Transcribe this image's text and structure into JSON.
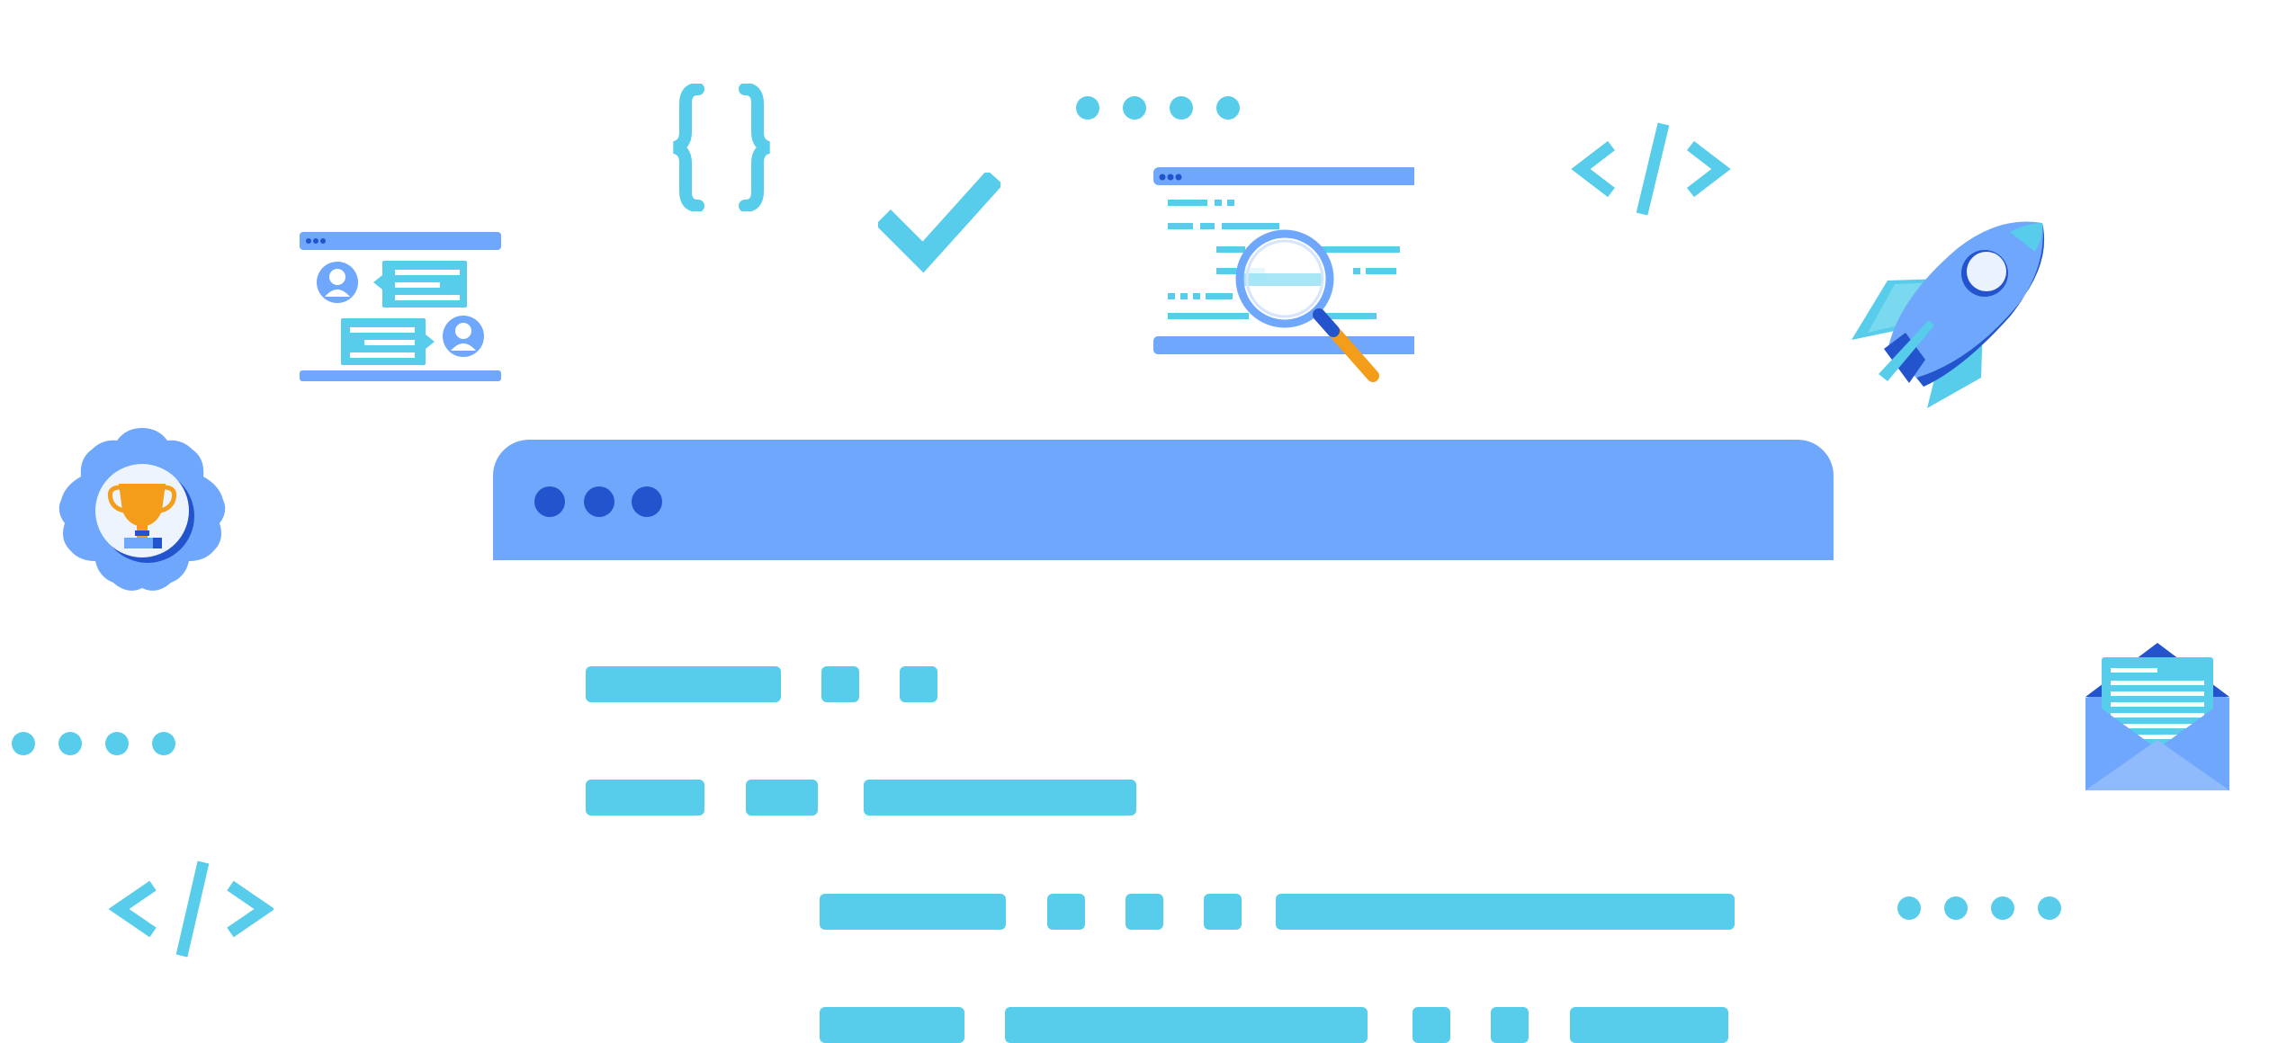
{
  "colors": {
    "primary_blue": "#6ea7fb",
    "dark_blue": "#2454cd",
    "cyan": "#57cdeb",
    "light_cyan": "#91e0f2",
    "orange": "#f39d1b",
    "white": "#ffffff"
  },
  "icons": [
    "chat-window-icon",
    "curly-braces-icon",
    "checkmark-icon",
    "dots-icon",
    "code-search-icon",
    "code-tag-icon",
    "rocket-icon",
    "award-badge-icon",
    "email-open-icon",
    "browser-window"
  ],
  "browser_window": {
    "traffic_dots": 3,
    "code_lines": [
      {
        "segments": 3
      },
      {
        "segments": 3
      },
      {
        "segments": 5
      },
      {
        "segments": 5
      }
    ]
  }
}
